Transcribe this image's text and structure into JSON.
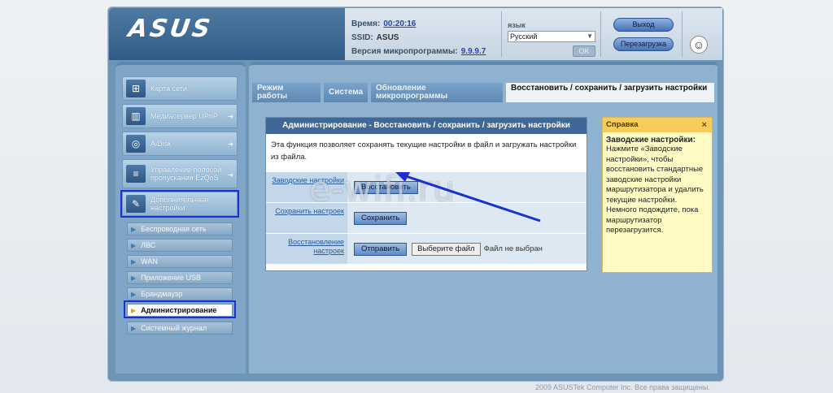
{
  "header": {
    "logo": "ASUS",
    "time_label": "Время:",
    "time_value": "00:20:16",
    "ssid_label": "SSID:",
    "ssid_value": "ASUS",
    "fw_label": "Версия микропрограммы:",
    "fw_value": "9.9.9.7",
    "lang_label": "язык",
    "lang_value": "Русский",
    "ok_label": "OK",
    "logout_label": "Выход",
    "reboot_label": "Перезагрузка"
  },
  "sidebar": {
    "items": [
      {
        "label": "Карта сети",
        "icon": "network-map-icon"
      },
      {
        "label": "Медиасервер UPnP",
        "icon": "media-server-icon"
      },
      {
        "label": "AiDisk",
        "icon": "aidisk-icon"
      },
      {
        "label": "Управление полосой пропускания EzQoS",
        "icon": "qos-icon"
      },
      {
        "label": "Дополнительные настройки",
        "icon": "tools-icon"
      }
    ],
    "sub_items": [
      {
        "label": "Беспроводная сеть"
      },
      {
        "label": "ЛВС"
      },
      {
        "label": "WAN"
      },
      {
        "label": "Приложение USB"
      },
      {
        "label": "Брандмауэр"
      },
      {
        "label": "Администрирование"
      },
      {
        "label": "Системный журнал"
      }
    ]
  },
  "tabs": [
    {
      "label": "Режим работы"
    },
    {
      "label": "Система"
    },
    {
      "label": "Обновление микропрограммы"
    },
    {
      "label": "Восстановить / сохранить / загрузить настройки"
    }
  ],
  "panel": {
    "title": "Администрирование - Восстановить / сохранить / загрузить настройки",
    "description": "Эта функция позволяет сохранять текущие настройки в файл и загружать настройки из файла.",
    "rows": [
      {
        "label": "Заводские настройки",
        "button": "Восстановить"
      },
      {
        "label": "Сохранить настроек",
        "button": "Сохранить"
      },
      {
        "label": "Восстановление настроек",
        "button": "Отправить",
        "file_button": "Выберите файл",
        "file_status": "Файл не выбран"
      }
    ]
  },
  "help": {
    "title": "Справка",
    "close": "×",
    "heading": "Заводские настройки:",
    "body": "Нажмите «Заводские настройки», чтобы восстановить стандартные заводские настройки маршрутизатора и удалить текущие настройки. Немного подождите, пока маршрутизатор перезагрузится."
  },
  "watermark": "e-wifi.ru",
  "footer": "2009 ASUSTek Computer Inc. Все права защищены.",
  "colors": {
    "highlight": "#1c2fcf",
    "arrow": "#1c2fcf",
    "panel_title": "#3f6896",
    "help_bg": "#fefbc5"
  }
}
